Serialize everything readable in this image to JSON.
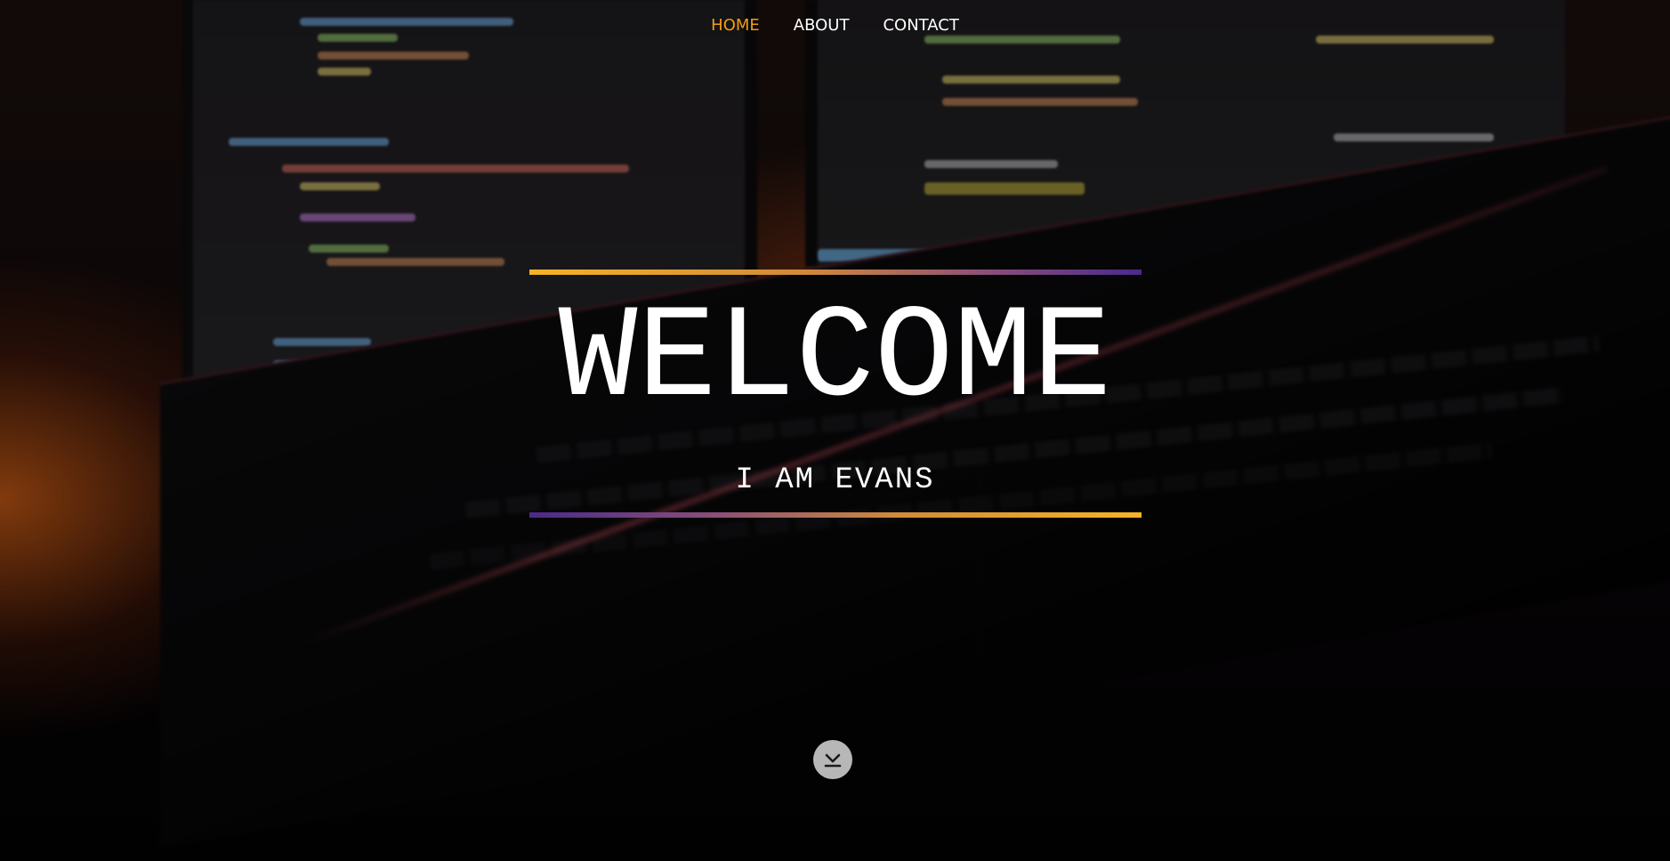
{
  "nav": {
    "items": [
      {
        "label": "HOME",
        "active": true
      },
      {
        "label": "ABOUT",
        "active": false
      },
      {
        "label": "CONTACT",
        "active": false
      }
    ],
    "active_color": "#f39c12"
  },
  "hero": {
    "title": "WELCOME",
    "subtitle": "I AM EVANS",
    "accent_colors": [
      "#f5b325",
      "#4a2a8a"
    ],
    "scroll_icon": "chevron-down-bar-icon"
  }
}
